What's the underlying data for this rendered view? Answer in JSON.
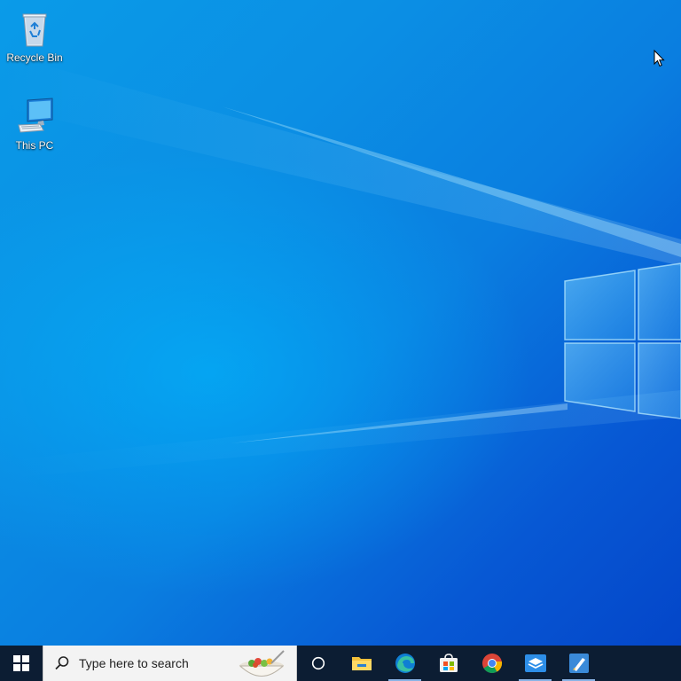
{
  "desktop": {
    "icons": [
      {
        "label": "Recycle Bin",
        "icon": "recycle-bin-icon"
      },
      {
        "label": "This PC",
        "icon": "computer-icon"
      }
    ]
  },
  "taskbar": {
    "start_icon": "windows-logo-icon",
    "search": {
      "placeholder": "Type here to search",
      "icon": "search-icon",
      "highlight_icon": "salad-bowl-icon"
    },
    "task_view_icon": "cortana-circle-icon",
    "apps": [
      {
        "name": "file-explorer-icon",
        "running": false
      },
      {
        "name": "edge-icon",
        "running": true
      },
      {
        "name": "microsoft-store-icon",
        "running": false
      },
      {
        "name": "chrome-icon",
        "running": false
      },
      {
        "name": "app-box-icon",
        "running": true
      },
      {
        "name": "paint-icon",
        "running": true
      }
    ]
  },
  "colors": {
    "taskbar": "#0c1d33",
    "desktop_light": "#0aa6ec",
    "desktop_dark": "#0446c9",
    "search_bg": "#f3f3f3"
  }
}
